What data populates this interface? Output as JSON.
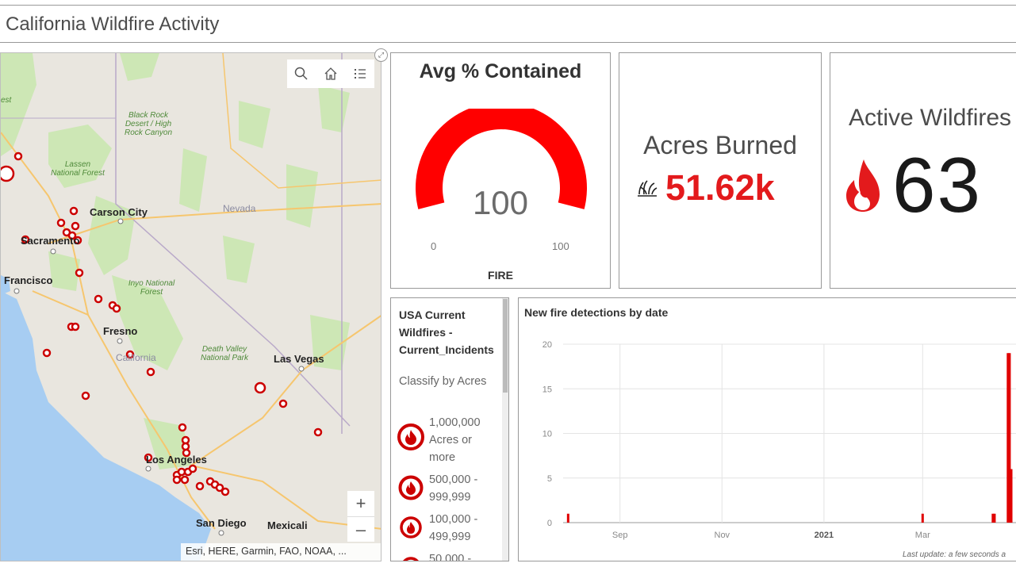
{
  "header": {
    "title": "California Wildfire Activity"
  },
  "map": {
    "attribution": "Esri, HERE, Garmin, FAO, NOAA, ...",
    "zoom_in": "+",
    "zoom_out": "–",
    "labels": {
      "black_rock": "Black Rock Desert / High Rock Canyon",
      "lassen": "Lassen National Forest",
      "carson_city": "Carson City",
      "nevada": "Nevada",
      "sacramento": "Sacramento",
      "francisco": "Francisco",
      "inyo": "Inyo National Forest",
      "fresno": "Fresno",
      "california": "California",
      "death_valley": "Death Valley National Park",
      "las_vegas": "Las Vegas",
      "los_angeles": "Los Angeles",
      "san_diego": "San Diego",
      "mexicali": "Mexicali",
      "edge_label": "est"
    },
    "colors": {
      "land": "#e9e6df",
      "water": "#a7cdf2",
      "forest": "#cde7b5",
      "roads": "#f6d38c",
      "marker": "#cc0000"
    }
  },
  "gauge": {
    "title": "Avg % Contained",
    "value": "100",
    "min": "0",
    "max": "100",
    "label": "FIRE",
    "fraction": 1.0,
    "color": "#ff0000"
  },
  "acres": {
    "title": "Acres Burned",
    "value": "51.62k",
    "icon": "grass-fire-icon",
    "color": "#e31a1c"
  },
  "active": {
    "title": "Active Wildfires",
    "value": "63",
    "icon": "flame-icon"
  },
  "legend": {
    "title": "USA Current Wildfires - Current_Incidents",
    "subtitle": "Classify by Acres",
    "items": [
      {
        "label": "1,000,000 Acres or more"
      },
      {
        "label": "500,000 - 999,999"
      },
      {
        "label": "100,000 - 499,999"
      },
      {
        "label": "50,000 -"
      }
    ]
  },
  "chart_data": {
    "type": "bar",
    "title": "New fire detections by date",
    "ylim": [
      0,
      20
    ],
    "yticks": [
      "0",
      "5",
      "10",
      "15",
      "20"
    ],
    "xticks": [
      "Sep",
      "Nov",
      "2021",
      "Mar"
    ],
    "series": [
      {
        "values": [
          {
            "date": "2020-08-01",
            "y": 1
          },
          {
            "date": "2021-03-01",
            "y": 1
          },
          {
            "date": "2021-04-12",
            "y": 1
          },
          {
            "date": "2021-04-13",
            "y": 1
          },
          {
            "date": "2021-04-21",
            "y": 19
          },
          {
            "date": "2021-04-22",
            "y": 19
          },
          {
            "date": "2021-04-23",
            "y": 6
          }
        ]
      }
    ],
    "footer": "Last update: a few seconds a",
    "color": "#e00000"
  }
}
